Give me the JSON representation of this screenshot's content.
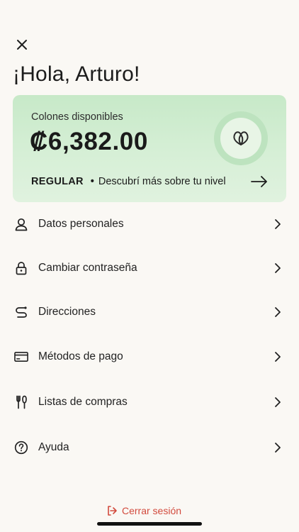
{
  "header": {
    "greeting": "¡Hola, Arturo!"
  },
  "balance_card": {
    "label": "Colones disponibles",
    "amount": "₡6,382.00",
    "level": "REGULAR",
    "separator": "•",
    "level_link": "Descubrí más sobre tu nivel",
    "badge_icon": "double-leaf-icon",
    "accent": "#c7e9c8"
  },
  "menu": {
    "items": [
      {
        "label": "Datos personales",
        "icon": "user-icon"
      },
      {
        "label": "Cambiar contraseña",
        "icon": "lock-icon"
      },
      {
        "label": "Direcciones",
        "icon": "route-icon"
      },
      {
        "label": "Métodos de pago",
        "icon": "credit-card-icon"
      },
      {
        "label": "Listas de compras",
        "icon": "utensils-icon"
      },
      {
        "label": "Ayuda",
        "icon": "help-icon"
      }
    ]
  },
  "footer": {
    "logout_label": "Cerrar sesión",
    "logout_color": "#d24a3d"
  }
}
